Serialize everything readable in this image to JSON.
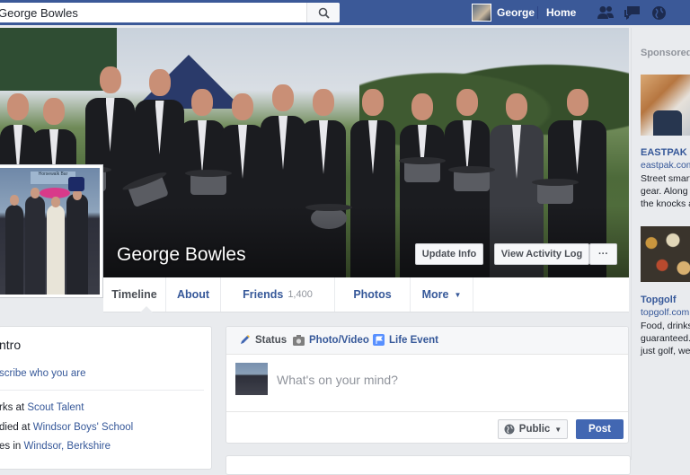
{
  "topbar": {
    "search_value": "George Bowles",
    "user_name": "George",
    "home_label": "Home",
    "icons": [
      "search-icon",
      "friend-requests-icon",
      "messages-icon",
      "notifications-globe-icon"
    ]
  },
  "cover": {
    "name": "George Bowles",
    "update_info": "Update Info",
    "view_activity_log": "View Activity Log",
    "more": "···",
    "profile_sign": "Horsewalk Bar"
  },
  "nav": {
    "timeline": "Timeline",
    "about": "About",
    "friends": "Friends",
    "friends_count": "1,400",
    "photos": "Photos",
    "more": "More"
  },
  "intro": {
    "title": "ntro",
    "describe": "scribe who you are",
    "lines": [
      {
        "prefix": "rks at ",
        "link": "Scout Talent"
      },
      {
        "prefix": "died at ",
        "link": "Windsor Boys' School"
      },
      {
        "prefix": "es in ",
        "link": "Windsor, Berkshire"
      }
    ]
  },
  "composer": {
    "status": "Status",
    "photo_video": "Photo/Video",
    "life_event": "Life Event",
    "placeholder": "What's on your mind?",
    "audience": "Public",
    "post": "Post"
  },
  "sidebar": {
    "sponsored": "Sponsored",
    "ads": [
      {
        "title": "EASTPAK - A",
        "url": "eastpak.com",
        "desc": [
          "Street smart l",
          "gear. Along fo",
          "the knocks as"
        ]
      },
      {
        "title": "Topgolf",
        "url": "topgolf.com",
        "desc": [
          "Food, drinks",
          "guaranteed. W",
          "just golf, we'r"
        ]
      }
    ]
  },
  "colors": {
    "brand": "#3b5998",
    "link": "#365899",
    "post_button": "#4267b2",
    "background": "#e9ebee"
  }
}
